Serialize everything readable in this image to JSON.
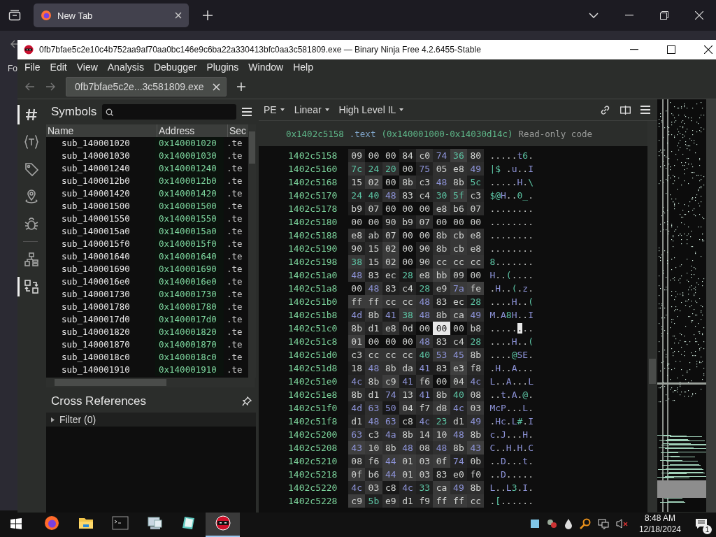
{
  "browser": {
    "tab": {
      "title": "New Tab",
      "selected": true
    },
    "page_text": "Fo"
  },
  "window": {
    "title": "0fb7bfae5c2e10c4b752aa9af70aa0bc146e9c6ba22a330413bfc0aa3c581809.exe — Binary Ninja Free 4.2.6455-Stable",
    "menu": [
      "File",
      "Edit",
      "View",
      "Analysis",
      "Debugger",
      "Plugins",
      "Window",
      "Help"
    ],
    "tabs": [
      {
        "label": "0fb7bfae5c2e...3c581809.exe",
        "selected": true
      }
    ]
  },
  "sidebar_icons": [
    {
      "kind": "symbols",
      "selected": true
    },
    {
      "kind": "types",
      "selected": false
    },
    {
      "kind": "tags",
      "selected": false
    },
    {
      "kind": "location",
      "selected": false
    },
    {
      "kind": "bug",
      "selected": false
    },
    {
      "kind": "hierarchy",
      "selected": false
    },
    {
      "kind": "xrefs",
      "selected": true
    }
  ],
  "symbols": {
    "title": "Symbols",
    "columns": [
      "Name",
      "Address",
      "Sec"
    ],
    "rows": [
      {
        "name": "sub_140001020",
        "address": "0x140001020",
        "section": ".te"
      },
      {
        "name": "sub_140001030",
        "address": "0x140001030",
        "section": ".te"
      },
      {
        "name": "sub_140001240",
        "address": "0x140001240",
        "section": ".te"
      },
      {
        "name": "sub_1400012b0",
        "address": "0x1400012b0",
        "section": ".te"
      },
      {
        "name": "sub_140001420",
        "address": "0x140001420",
        "section": ".te"
      },
      {
        "name": "sub_140001500",
        "address": "0x140001500",
        "section": ".te"
      },
      {
        "name": "sub_140001550",
        "address": "0x140001550",
        "section": ".te"
      },
      {
        "name": "sub_1400015a0",
        "address": "0x1400015a0",
        "section": ".te"
      },
      {
        "name": "sub_1400015f0",
        "address": "0x1400015f0",
        "section": ".te"
      },
      {
        "name": "sub_140001640",
        "address": "0x140001640",
        "section": ".te"
      },
      {
        "name": "sub_140001690",
        "address": "0x140001690",
        "section": ".te"
      },
      {
        "name": "sub_1400016e0",
        "address": "0x1400016e0",
        "section": ".te"
      },
      {
        "name": "sub_140001730",
        "address": "0x140001730",
        "section": ".te"
      },
      {
        "name": "sub_140001780",
        "address": "0x140001780",
        "section": ".te"
      },
      {
        "name": "sub_1400017d0",
        "address": "0x1400017d0",
        "section": ".te"
      },
      {
        "name": "sub_140001820",
        "address": "0x140001820",
        "section": ".te"
      },
      {
        "name": "sub_140001870",
        "address": "0x140001870",
        "section": ".te"
      },
      {
        "name": "sub_1400018c0",
        "address": "0x1400018c0",
        "section": ".te"
      },
      {
        "name": "sub_140001910",
        "address": "0x140001910",
        "section": ".te"
      }
    ]
  },
  "cross_references": {
    "title": "Cross References",
    "filter": "Filter (0)",
    "expanded": false
  },
  "hex_view": {
    "toolbar": [
      "PE",
      "Linear",
      "High Level IL"
    ],
    "info": {
      "address": "0x1402c5158",
      "section": ".text",
      "range": "(0x140001000-0x14030d14c)",
      "permission": "Read-only code"
    },
    "rows": [
      {
        "address": "1402c5158",
        "bytes": [
          {
            "hex": "09",
            "selected": false
          },
          {
            "hex": "00",
            "selected": false
          },
          {
            "hex": "00",
            "selected": false
          },
          {
            "hex": "84",
            "selected": false
          },
          {
            "hex": "c0",
            "selected": false
          },
          {
            "hex": "74",
            "selected": false
          },
          {
            "hex": "36",
            "selected": false
          },
          {
            "hex": "80",
            "selected": false
          }
        ],
        "ascii": ".....t6."
      },
      {
        "address": "1402c5160",
        "bytes": [
          {
            "hex": "7c",
            "selected": false
          },
          {
            "hex": "24",
            "selected": false
          },
          {
            "hex": "20",
            "selected": false
          },
          {
            "hex": "00",
            "selected": false
          },
          {
            "hex": "75",
            "selected": false
          },
          {
            "hex": "05",
            "selected": false
          },
          {
            "hex": "e8",
            "selected": false
          },
          {
            "hex": "49",
            "selected": false
          }
        ],
        "ascii": "|$ .u..I"
      },
      {
        "address": "1402c5168",
        "bytes": [
          {
            "hex": "15",
            "selected": false
          },
          {
            "hex": "02",
            "selected": false
          },
          {
            "hex": "00",
            "selected": false
          },
          {
            "hex": "8b",
            "selected": false
          },
          {
            "hex": "c3",
            "selected": false
          },
          {
            "hex": "48",
            "selected": false
          },
          {
            "hex": "8b",
            "selected": false
          },
          {
            "hex": "5c",
            "selected": false
          }
        ],
        "ascii": ".....H.\\"
      },
      {
        "address": "1402c5170",
        "bytes": [
          {
            "hex": "24",
            "selected": false
          },
          {
            "hex": "40",
            "selected": false
          },
          {
            "hex": "48",
            "selected": false
          },
          {
            "hex": "83",
            "selected": false
          },
          {
            "hex": "c4",
            "selected": false
          },
          {
            "hex": "30",
            "selected": false
          },
          {
            "hex": "5f",
            "selected": false
          },
          {
            "hex": "c3",
            "selected": false
          }
        ],
        "ascii": "$@H..0_."
      },
      {
        "address": "1402c5178",
        "bytes": [
          {
            "hex": "b9",
            "selected": false
          },
          {
            "hex": "07",
            "selected": false
          },
          {
            "hex": "00",
            "selected": false
          },
          {
            "hex": "00",
            "selected": false
          },
          {
            "hex": "00",
            "selected": false
          },
          {
            "hex": "e8",
            "selected": false
          },
          {
            "hex": "b6",
            "selected": false
          },
          {
            "hex": "07",
            "selected": false
          }
        ],
        "ascii": "........"
      },
      {
        "address": "1402c5180",
        "bytes": [
          {
            "hex": "00",
            "selected": false
          },
          {
            "hex": "00",
            "selected": false
          },
          {
            "hex": "90",
            "selected": false
          },
          {
            "hex": "b9",
            "selected": false
          },
          {
            "hex": "07",
            "selected": false
          },
          {
            "hex": "00",
            "selected": false
          },
          {
            "hex": "00",
            "selected": false
          },
          {
            "hex": "00",
            "selected": false
          }
        ],
        "ascii": "........"
      },
      {
        "address": "1402c5188",
        "bytes": [
          {
            "hex": "e8",
            "selected": false
          },
          {
            "hex": "ab",
            "selected": false
          },
          {
            "hex": "07",
            "selected": false
          },
          {
            "hex": "00",
            "selected": false
          },
          {
            "hex": "00",
            "selected": false
          },
          {
            "hex": "8b",
            "selected": false
          },
          {
            "hex": "cb",
            "selected": false
          },
          {
            "hex": "e8",
            "selected": false
          }
        ],
        "ascii": "........"
      },
      {
        "address": "1402c5190",
        "bytes": [
          {
            "hex": "90",
            "selected": false
          },
          {
            "hex": "15",
            "selected": false
          },
          {
            "hex": "02",
            "selected": false
          },
          {
            "hex": "00",
            "selected": false
          },
          {
            "hex": "90",
            "selected": false
          },
          {
            "hex": "8b",
            "selected": false
          },
          {
            "hex": "cb",
            "selected": false
          },
          {
            "hex": "e8",
            "selected": false
          }
        ],
        "ascii": "........"
      },
      {
        "address": "1402c5198",
        "bytes": [
          {
            "hex": "38",
            "selected": false
          },
          {
            "hex": "15",
            "selected": false
          },
          {
            "hex": "02",
            "selected": false
          },
          {
            "hex": "00",
            "selected": false
          },
          {
            "hex": "90",
            "selected": false
          },
          {
            "hex": "cc",
            "selected": false
          },
          {
            "hex": "cc",
            "selected": false
          },
          {
            "hex": "cc",
            "selected": false
          }
        ],
        "ascii": "8......."
      },
      {
        "address": "1402c51a0",
        "bytes": [
          {
            "hex": "48",
            "selected": false
          },
          {
            "hex": "83",
            "selected": false
          },
          {
            "hex": "ec",
            "selected": false
          },
          {
            "hex": "28",
            "selected": false
          },
          {
            "hex": "e8",
            "selected": false
          },
          {
            "hex": "bb",
            "selected": false
          },
          {
            "hex": "09",
            "selected": false
          },
          {
            "hex": "00",
            "selected": false
          }
        ],
        "ascii": "H..(...."
      },
      {
        "address": "1402c51a8",
        "bytes": [
          {
            "hex": "00",
            "selected": false
          },
          {
            "hex": "48",
            "selected": false
          },
          {
            "hex": "83",
            "selected": false
          },
          {
            "hex": "c4",
            "selected": false
          },
          {
            "hex": "28",
            "selected": false
          },
          {
            "hex": "e9",
            "selected": false
          },
          {
            "hex": "7a",
            "selected": false
          },
          {
            "hex": "fe",
            "selected": false
          }
        ],
        "ascii": ".H..(.z."
      },
      {
        "address": "1402c51b0",
        "bytes": [
          {
            "hex": "ff",
            "selected": false
          },
          {
            "hex": "ff",
            "selected": false
          },
          {
            "hex": "cc",
            "selected": false
          },
          {
            "hex": "cc",
            "selected": false
          },
          {
            "hex": "48",
            "selected": false
          },
          {
            "hex": "83",
            "selected": false
          },
          {
            "hex": "ec",
            "selected": false
          },
          {
            "hex": "28",
            "selected": false
          }
        ],
        "ascii": "....H..("
      },
      {
        "address": "1402c51b8",
        "bytes": [
          {
            "hex": "4d",
            "selected": false
          },
          {
            "hex": "8b",
            "selected": false
          },
          {
            "hex": "41",
            "selected": false
          },
          {
            "hex": "38",
            "selected": false
          },
          {
            "hex": "48",
            "selected": false
          },
          {
            "hex": "8b",
            "selected": false
          },
          {
            "hex": "ca",
            "selected": false
          },
          {
            "hex": "49",
            "selected": false
          }
        ],
        "ascii": "M.A8H..I"
      },
      {
        "address": "1402c51c0",
        "bytes": [
          {
            "hex": "8b",
            "selected": false
          },
          {
            "hex": "d1",
            "selected": false
          },
          {
            "hex": "e8",
            "selected": false
          },
          {
            "hex": "0d",
            "selected": false
          },
          {
            "hex": "00",
            "selected": false
          },
          {
            "hex": "00",
            "selected": true
          },
          {
            "hex": "00",
            "selected": false
          },
          {
            "hex": "b8",
            "selected": false
          }
        ],
        "ascii": "........"
      },
      {
        "address": "1402c51c8",
        "bytes": [
          {
            "hex": "01",
            "selected": false
          },
          {
            "hex": "00",
            "selected": false
          },
          {
            "hex": "00",
            "selected": false
          },
          {
            "hex": "00",
            "selected": false
          },
          {
            "hex": "48",
            "selected": false
          },
          {
            "hex": "83",
            "selected": false
          },
          {
            "hex": "c4",
            "selected": false
          },
          {
            "hex": "28",
            "selected": false
          }
        ],
        "ascii": "....H..("
      },
      {
        "address": "1402c51d0",
        "bytes": [
          {
            "hex": "c3",
            "selected": false
          },
          {
            "hex": "cc",
            "selected": false
          },
          {
            "hex": "cc",
            "selected": false
          },
          {
            "hex": "cc",
            "selected": false
          },
          {
            "hex": "40",
            "selected": false
          },
          {
            "hex": "53",
            "selected": false
          },
          {
            "hex": "45",
            "selected": false
          },
          {
            "hex": "8b",
            "selected": false
          }
        ],
        "ascii": "....@SE."
      },
      {
        "address": "1402c51d8",
        "bytes": [
          {
            "hex": "18",
            "selected": false
          },
          {
            "hex": "48",
            "selected": false
          },
          {
            "hex": "8b",
            "selected": false
          },
          {
            "hex": "da",
            "selected": false
          },
          {
            "hex": "41",
            "selected": false
          },
          {
            "hex": "83",
            "selected": false
          },
          {
            "hex": "e3",
            "selected": false
          },
          {
            "hex": "f8",
            "selected": false
          }
        ],
        "ascii": ".H..A..."
      },
      {
        "address": "1402c51e0",
        "bytes": [
          {
            "hex": "4c",
            "selected": false
          },
          {
            "hex": "8b",
            "selected": false
          },
          {
            "hex": "c9",
            "selected": false
          },
          {
            "hex": "41",
            "selected": false
          },
          {
            "hex": "f6",
            "selected": false
          },
          {
            "hex": "00",
            "selected": false
          },
          {
            "hex": "04",
            "selected": false
          },
          {
            "hex": "4c",
            "selected": false
          }
        ],
        "ascii": "L..A...L"
      },
      {
        "address": "1402c51e8",
        "bytes": [
          {
            "hex": "8b",
            "selected": false
          },
          {
            "hex": "d1",
            "selected": false
          },
          {
            "hex": "74",
            "selected": false
          },
          {
            "hex": "13",
            "selected": false
          },
          {
            "hex": "41",
            "selected": false
          },
          {
            "hex": "8b",
            "selected": false
          },
          {
            "hex": "40",
            "selected": false
          },
          {
            "hex": "08",
            "selected": false
          }
        ],
        "ascii": "..t.A.@."
      },
      {
        "address": "1402c51f0",
        "bytes": [
          {
            "hex": "4d",
            "selected": false
          },
          {
            "hex": "63",
            "selected": false
          },
          {
            "hex": "50",
            "selected": false
          },
          {
            "hex": "04",
            "selected": false
          },
          {
            "hex": "f7",
            "selected": false
          },
          {
            "hex": "d8",
            "selected": false
          },
          {
            "hex": "4c",
            "selected": false
          },
          {
            "hex": "03",
            "selected": false
          }
        ],
        "ascii": "McP...L."
      },
      {
        "address": "1402c51f8",
        "bytes": [
          {
            "hex": "d1",
            "selected": false
          },
          {
            "hex": "48",
            "selected": false
          },
          {
            "hex": "63",
            "selected": false
          },
          {
            "hex": "c8",
            "selected": false
          },
          {
            "hex": "4c",
            "selected": false
          },
          {
            "hex": "23",
            "selected": false
          },
          {
            "hex": "d1",
            "selected": false
          },
          {
            "hex": "49",
            "selected": false
          }
        ],
        "ascii": ".Hc.L#.I"
      },
      {
        "address": "1402c5200",
        "bytes": [
          {
            "hex": "63",
            "selected": false
          },
          {
            "hex": "c3",
            "selected": false
          },
          {
            "hex": "4a",
            "selected": false
          },
          {
            "hex": "8b",
            "selected": false
          },
          {
            "hex": "14",
            "selected": false
          },
          {
            "hex": "10",
            "selected": false
          },
          {
            "hex": "48",
            "selected": false
          },
          {
            "hex": "8b",
            "selected": false
          }
        ],
        "ascii": "c.J...H."
      },
      {
        "address": "1402c5208",
        "bytes": [
          {
            "hex": "43",
            "selected": false
          },
          {
            "hex": "10",
            "selected": false
          },
          {
            "hex": "8b",
            "selected": false
          },
          {
            "hex": "48",
            "selected": false
          },
          {
            "hex": "08",
            "selected": false
          },
          {
            "hex": "48",
            "selected": false
          },
          {
            "hex": "8b",
            "selected": false
          },
          {
            "hex": "43",
            "selected": false
          }
        ],
        "ascii": "C..H.H.C"
      },
      {
        "address": "1402c5210",
        "bytes": [
          {
            "hex": "08",
            "selected": false
          },
          {
            "hex": "f6",
            "selected": false
          },
          {
            "hex": "44",
            "selected": false
          },
          {
            "hex": "01",
            "selected": false
          },
          {
            "hex": "03",
            "selected": false
          },
          {
            "hex": "0f",
            "selected": false
          },
          {
            "hex": "74",
            "selected": false
          },
          {
            "hex": "0b",
            "selected": false
          }
        ],
        "ascii": "..D...t."
      },
      {
        "address": "1402c5218",
        "bytes": [
          {
            "hex": "0f",
            "selected": false
          },
          {
            "hex": "b6",
            "selected": false
          },
          {
            "hex": "44",
            "selected": false
          },
          {
            "hex": "01",
            "selected": false
          },
          {
            "hex": "03",
            "selected": false
          },
          {
            "hex": "83",
            "selected": false
          },
          {
            "hex": "e0",
            "selected": false
          },
          {
            "hex": "f0",
            "selected": false
          }
        ],
        "ascii": "..D....."
      },
      {
        "address": "1402c5220",
        "bytes": [
          {
            "hex": "4c",
            "selected": false
          },
          {
            "hex": "03",
            "selected": false
          },
          {
            "hex": "c8",
            "selected": false
          },
          {
            "hex": "4c",
            "selected": false
          },
          {
            "hex": "33",
            "selected": false
          },
          {
            "hex": "ca",
            "selected": false
          },
          {
            "hex": "49",
            "selected": false
          },
          {
            "hex": "8b",
            "selected": false
          }
        ],
        "ascii": "L..L3.I."
      },
      {
        "address": "1402c5228",
        "bytes": [
          {
            "hex": "c9",
            "selected": false
          },
          {
            "hex": "5b",
            "selected": false
          },
          {
            "hex": "e9",
            "selected": false
          },
          {
            "hex": "d1",
            "selected": false
          },
          {
            "hex": "f9",
            "selected": false
          },
          {
            "hex": "ff",
            "selected": false
          },
          {
            "hex": "ff",
            "selected": false
          },
          {
            "hex": "cc",
            "selected": false
          }
        ],
        "ascii": ".[......"
      }
    ]
  },
  "taskbar": {
    "apps": [
      {
        "kind": "firefox",
        "selected": false
      },
      {
        "kind": "folder",
        "selected": false
      },
      {
        "kind": "terminal",
        "selected": false
      },
      {
        "kind": "computer",
        "selected": false
      },
      {
        "kind": "notepad",
        "selected": false
      },
      {
        "kind": "ninja",
        "selected": true
      }
    ],
    "time": "8:48 AM",
    "date": "12/18/2024",
    "notifications": "1"
  }
}
